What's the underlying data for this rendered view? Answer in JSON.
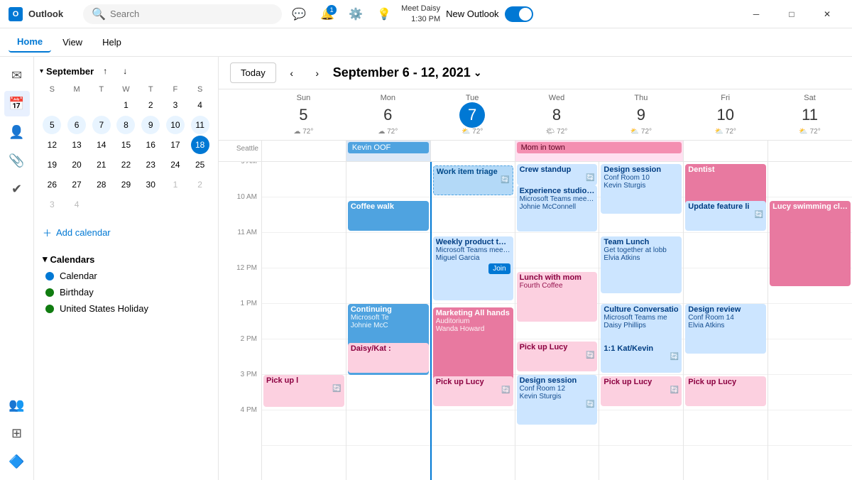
{
  "app": {
    "name": "Outlook",
    "icon": "O"
  },
  "titlebar": {
    "search_placeholder": "Search",
    "notifications_count": "1",
    "meet_daisy_label": "Meet Daisy",
    "meet_daisy_time": "1:30 PM",
    "new_outlook_label": "New Outlook"
  },
  "menu": {
    "items": [
      "Home",
      "View",
      "Help"
    ]
  },
  "sidebar": {
    "icons": [
      "✉",
      "📅",
      "👤",
      "📎",
      "✔",
      "👥",
      "≡",
      "🔷",
      "⚡"
    ]
  },
  "mini_calendar": {
    "month": "September",
    "collapse_icon": "▾",
    "nav_prev": "↑",
    "nav_next": "↓",
    "day_headers": [
      "S",
      "M",
      "T",
      "W",
      "T",
      "F",
      "S"
    ],
    "weeks": [
      [
        {
          "d": "",
          "other": true
        },
        {
          "d": "",
          "other": true
        },
        {
          "d": "",
          "other": true
        },
        {
          "d": "1"
        },
        {
          "d": "2"
        },
        {
          "d": "3"
        },
        {
          "d": "4"
        }
      ],
      [
        {
          "d": "5"
        },
        {
          "d": "6"
        },
        {
          "d": "7"
        },
        {
          "d": "8"
        },
        {
          "d": "9"
        },
        {
          "d": "10"
        },
        {
          "d": "11"
        }
      ],
      [
        {
          "d": "12"
        },
        {
          "d": "13"
        },
        {
          "d": "14"
        },
        {
          "d": "15"
        },
        {
          "d": "16"
        },
        {
          "d": "17"
        },
        {
          "d": "18",
          "today": true
        }
      ],
      [
        {
          "d": "19"
        },
        {
          "d": "20"
        },
        {
          "d": "21"
        },
        {
          "d": "22"
        },
        {
          "d": "23"
        },
        {
          "d": "24"
        },
        {
          "d": "25"
        }
      ],
      [
        {
          "d": "26"
        },
        {
          "d": "27"
        },
        {
          "d": "28"
        },
        {
          "d": "29"
        },
        {
          "d": "30"
        },
        {
          "d": "1",
          "other": true
        },
        {
          "d": "2",
          "other": true
        }
      ],
      [
        {
          "d": "3",
          "other": true
        },
        {
          "d": "4",
          "other": true
        },
        {
          "d": "",
          "other": true
        },
        {
          "d": "",
          "other": true
        },
        {
          "d": "",
          "other": true
        },
        {
          "d": "",
          "other": true
        },
        {
          "d": "",
          "other": true
        }
      ]
    ]
  },
  "left_panel": {
    "add_calendar": "Add calendar",
    "calendars_label": "Calendars",
    "calendars": [
      {
        "name": "Calendar",
        "color": "#0078d4"
      },
      {
        "name": "Birthday",
        "color": "#107c10"
      },
      {
        "name": "United States Holiday",
        "color": "#107c10"
      }
    ]
  },
  "cal_header": {
    "today_btn": "Today",
    "date_range": "September 6 - 12, 2021",
    "chevron": "⌄"
  },
  "day_columns": [
    {
      "name": "Sun",
      "num": "5",
      "weather": "72°",
      "weather_icon": "☁"
    },
    {
      "name": "Mon",
      "num": "6",
      "weather": "72°",
      "weather_icon": "☁"
    },
    {
      "name": "Tue",
      "num": "7",
      "today": true,
      "weather": "72°",
      "weather_icon": "⛅"
    },
    {
      "name": "Wed",
      "num": "8",
      "weather": "72°",
      "weather_icon": "🌤"
    },
    {
      "name": "Thu",
      "num": "9",
      "weather": "72°",
      "weather_icon": "⛅"
    },
    {
      "name": "Fri",
      "num": "10",
      "weather": "72°",
      "weather_icon": "⛅"
    },
    {
      "name": "Sat",
      "num": "11",
      "weather": "72°",
      "weather_icon": "⛅"
    }
  ],
  "all_day_events": {
    "seattle_kevin": "Kevin OOF",
    "mom_in_town": "Mom in town"
  },
  "time_labels": [
    "9 AM",
    "10 AM",
    "11 AM",
    "12 PM",
    "1 PM",
    "2 PM",
    "3 PM",
    "4 PM"
  ],
  "events": {
    "work_item_triage": "Work item triage",
    "crew_standup": "Crew standup",
    "coffee_walk": "Coffee walk",
    "experience_studio": "Experience studio sync",
    "exp_detail1": "Microsoft Teams meeting",
    "exp_detail2": "Johnie McConnell",
    "design_session_thu": "Design session",
    "design_detail1": "Conf Room 10",
    "design_detail2": "Kevin Sturgis",
    "dentist": "Dentist",
    "update_feature": "Update feature li",
    "weekly_sync": "Weekly product team sync",
    "weekly_detail1": "Microsoft Teams meeting",
    "weekly_detail2": "Miguel Garcia",
    "join_btn": "Join",
    "team_lunch": "Team Lunch",
    "team_lunch_detail1": "Get together at lobb",
    "team_lunch_detail2": "Elvia Atkins",
    "lunch_with_mom": "Lunch with mom",
    "lunch_detail": "Fourth Coffee",
    "culture_conv": "Culture Conversatio",
    "culture_detail1": "Microsoft Teams me",
    "culture_detail2": "Daisy Phillips",
    "design_review": "Design review",
    "design_review_detail1": "Conf Room 14",
    "design_review_detail2": "Elvia Atkins",
    "continuing": "Continuing",
    "continuing_detail1": "Microsoft Te",
    "continuing_detail2": "Johnie McC",
    "marketing_all_hands": "Marketing All hands",
    "marketing_detail1": "Auditorium",
    "marketing_detail2": "Wanda Howard",
    "daisy_kat": "Daisy/Kat :",
    "pick_up_lucy_wed": "Pick up Lucy",
    "kat_kevin": "1:1 Kat/Kevin",
    "pick_up_lucy_sun": "Pick up l",
    "pick_up_lucy_tue": "Pick up Lucy",
    "design_session_wed": "Design session",
    "design_sess_detail1": "Conf Room 12",
    "design_sess_detail2": "Kevin Sturgis",
    "pick_up_lucy_thu": "Pick up Lucy",
    "pick_up_lucy_fri": "Pick up Lucy",
    "lucy_swimming": "Lucy swimming class"
  }
}
